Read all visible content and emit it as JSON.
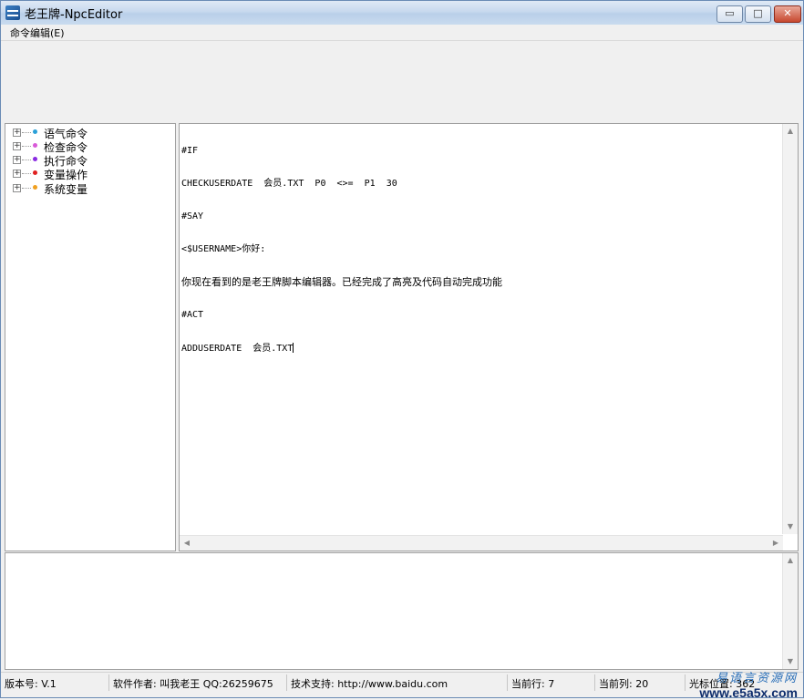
{
  "window": {
    "title": "老王牌-NpcEditor",
    "controls": {
      "minimize": "▭",
      "maximize": "□",
      "close": "✕"
    }
  },
  "menu": {
    "items": [
      {
        "label": "命令编辑(E)"
      }
    ]
  },
  "tree": {
    "items": [
      {
        "label": "语气命令",
        "bullet_color": "#2aa0d8"
      },
      {
        "label": "检查命令",
        "bullet_color": "#d85ad8"
      },
      {
        "label": "执行命令",
        "bullet_color": "#8a2be2"
      },
      {
        "label": "变量操作",
        "bullet_color": "#e02020"
      },
      {
        "label": "系统变量",
        "bullet_color": "#f0a020"
      }
    ]
  },
  "editor": {
    "lines": [
      "#IF",
      "CHECKUSERDATE  会员.TXT  P0  <>=  P1  30",
      "#SAY",
      "<$USERNAME>你好:",
      "你现在看到的是老王牌脚本编辑器。已经完成了高亮及代码自动完成功能",
      "#ACT",
      "ADDUSERDATE  会员.TXT"
    ]
  },
  "status": {
    "version": "版本号: V.1",
    "author": "软件作者: 叫我老王 QQ:26259675",
    "support": "技术支持: http://www.baidu.com",
    "current_row": "当前行: 7",
    "current_col": "当前列: 20",
    "cursor": "光标位置: 362"
  },
  "watermark": {
    "top": "易语言资源网",
    "bottom": "www.e5a5x.com"
  },
  "colors": {
    "title_bar": "#c7d9ee",
    "window_border": "#6a8bb5",
    "close_button": "#c7482f"
  }
}
